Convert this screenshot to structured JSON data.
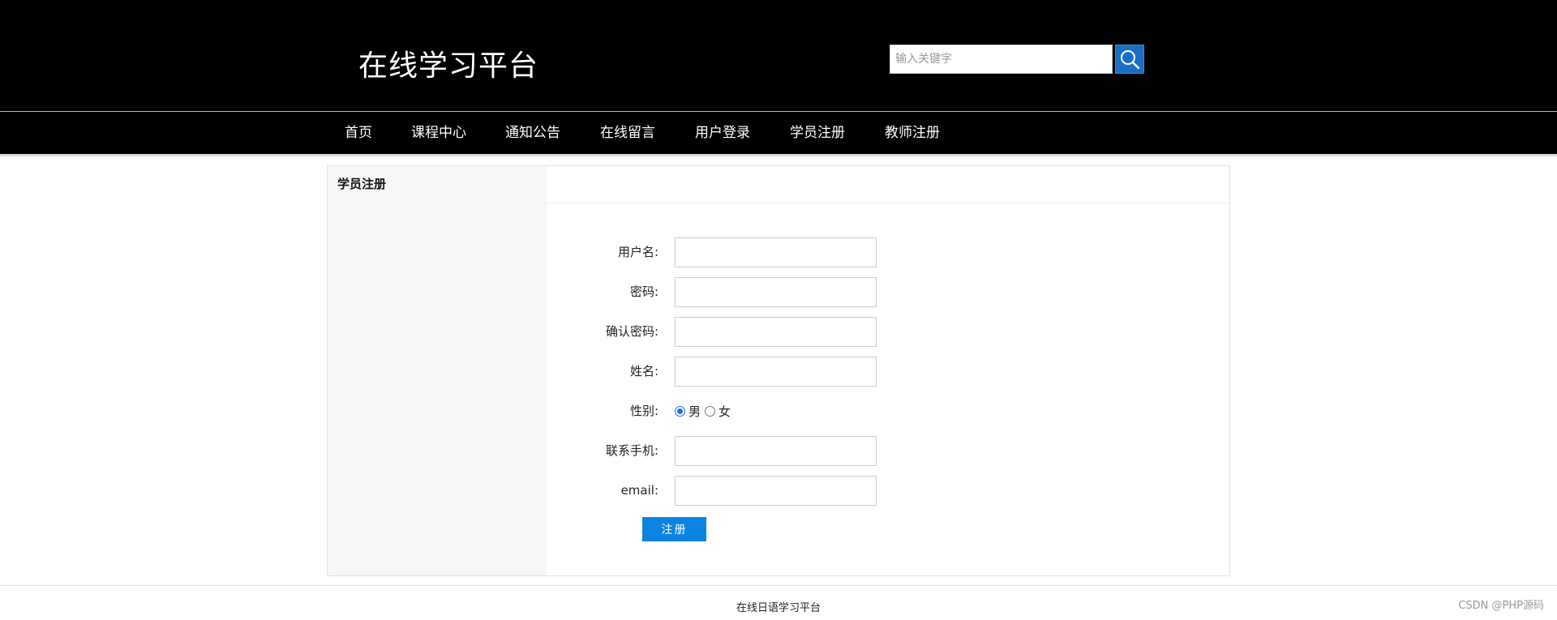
{
  "header": {
    "site_title": "在线学习平台",
    "search_placeholder": "输入关键字"
  },
  "nav": {
    "items": [
      {
        "label": "首页"
      },
      {
        "label": "课程中心"
      },
      {
        "label": "通知公告"
      },
      {
        "label": "在线留言"
      },
      {
        "label": "用户登录"
      },
      {
        "label": "学员注册"
      },
      {
        "label": "教师注册"
      }
    ]
  },
  "panel": {
    "heading": "学员注册"
  },
  "form": {
    "username_label": "用户名:",
    "password_label": "密码:",
    "confirm_password_label": "确认密码:",
    "name_label": "姓名:",
    "gender_label": "性别:",
    "gender_options": [
      {
        "label": "男",
        "checked": true
      },
      {
        "label": "女",
        "checked": false
      }
    ],
    "phone_label": "联系手机:",
    "email_label": "email:",
    "submit_label": "注册"
  },
  "footer": {
    "text": "在线日语学习平台"
  },
  "watermark": {
    "text": "CSDN @PHP源码"
  },
  "colors": {
    "header_bg": "#000000",
    "search_button_bg": "#1a6fc4",
    "submit_bg": "#0a84e0",
    "sidebar_bg": "#f7f7f7"
  }
}
